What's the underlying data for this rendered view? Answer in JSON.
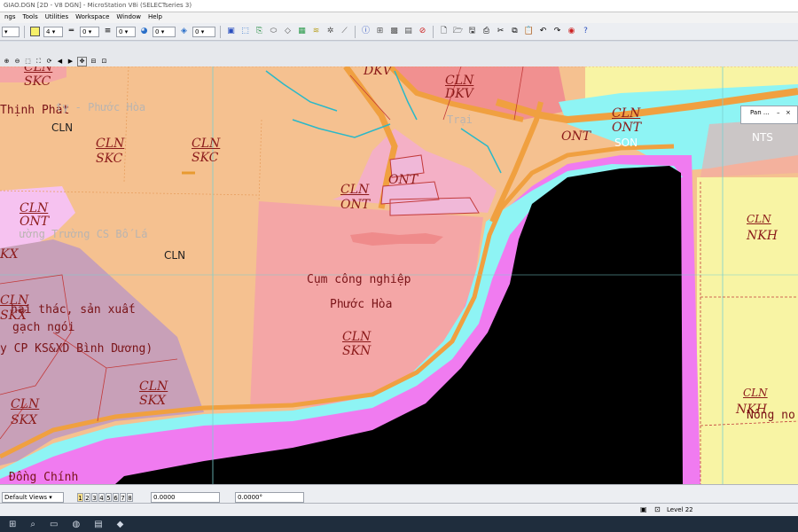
{
  "window": {
    "title": "GIAO.DGN [2D - V8 DGN] - MicroStation V8i (SELECTseries 3)"
  },
  "menu": [
    "ngs",
    "Tools",
    "Utilities",
    "Workspace",
    "Window",
    "Help"
  ],
  "toolbar": {
    "color_value": "",
    "level_value": "4",
    "weight_value": "0",
    "style_value": "0",
    "transparency_value": "0",
    "priority_value": "0"
  },
  "view_tools": {
    "count": 10
  },
  "map": {
    "labels": {
      "cln_topleft": "CLN",
      "skc_topleft": "SKC",
      "dkv_top": "DKV",
      "cln_dkv": "CLN",
      "dkv_mid": "DKV",
      "cln_ont_r": "CLN",
      "ont_r": "ONT",
      "son": "SON",
      "nts": "NTS",
      "thinh_phat": "Thịnh Phát",
      "phuoc_hoa_faded": "ty - Phước Hòa",
      "trai": "Trại",
      "cln_left": "CLN",
      "cln_skc2": "CLN",
      "skc2": "SKC",
      "cln_skc3": "CLN",
      "skc3": "SKC",
      "ont_small": "ONT",
      "cln_ont2": "CLN",
      "ont2": "ONT",
      "ont3": "ONT",
      "cln_ont_l": "CLN",
      "ont_l": "ONT",
      "truong_faded": "ường Trường CS Bố Lá",
      "cln_center": "CLN",
      "skx_1": "KX",
      "cln_nkh_top": "CLN",
      "nkh_top": "NKH",
      "cum_cn": "Cụm công nghiệp",
      "phuoc_hoa": "Phước Hòa",
      "cln_skx_l": "CLN",
      "skx_l": "SKX",
      "khai_thac": "hai thác, sản xuất",
      "gach_ngoi": "gạch ngói",
      "cty": "y CP KS&XD Bình Dương)",
      "cln_skn": "CLN",
      "skn": "SKN",
      "cln_skx_m": "CLN",
      "skx_m": "SKX",
      "cln_skx_b": "CLN",
      "skx_b": "SKX",
      "cln_nkh_b": "CLN",
      "nkh_b": "NKH",
      "nong_no": "Nông no",
      "dong_chinh": "Đồng Chính"
    },
    "colors": {
      "orange_land": "#f5c190",
      "pink_residential": "#f4a6a6",
      "deep_pink": "#f19090",
      "magenta_edge": "#f07bf0",
      "cyan_water": "#8ef4f4",
      "black_void": "#000000",
      "yellow_field": "#f8f4a4",
      "purple_zone": "#c8a0b8",
      "road_orange": "#f0a040"
    }
  },
  "pan_window": {
    "title": "Pan ..."
  },
  "status": {
    "view_select": "Default Views",
    "views": [
      "1",
      "2",
      "3",
      "4",
      "5",
      "6",
      "7",
      "8"
    ],
    "x_value": "0.0000",
    "angle_value": "0.0000°",
    "level": "Level 22"
  }
}
